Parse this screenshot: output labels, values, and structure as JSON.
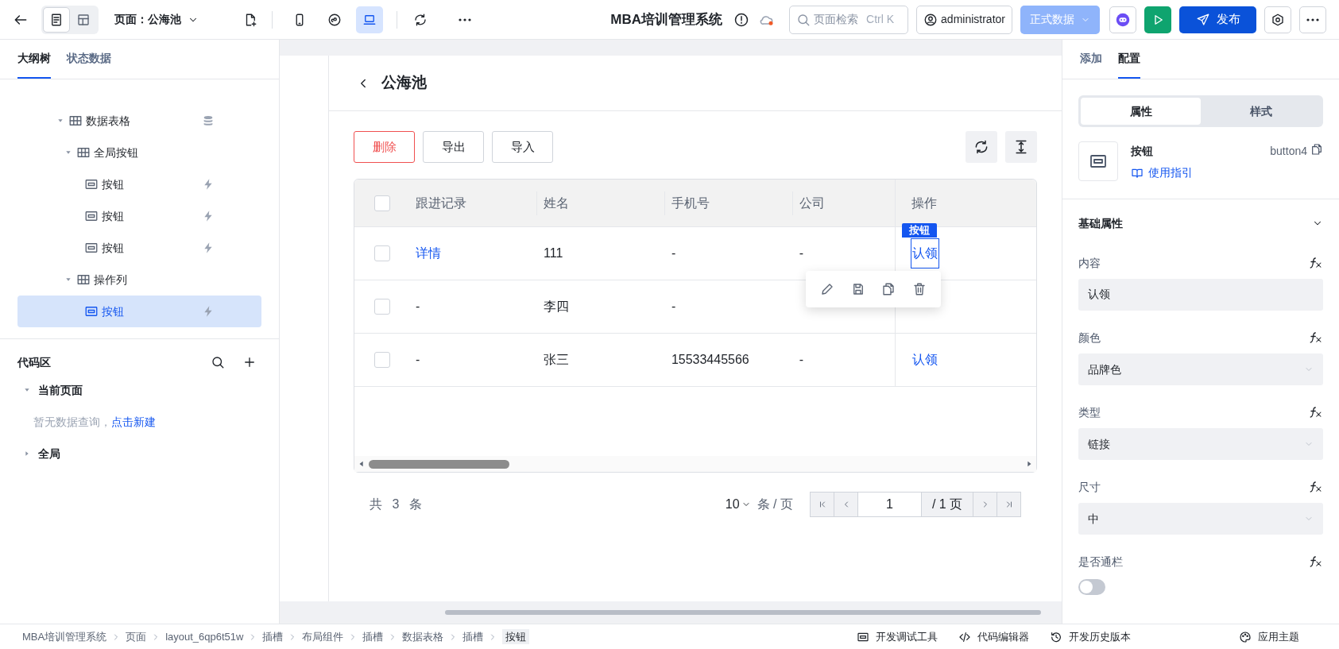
{
  "topbar": {
    "page_label": "页面：公海池",
    "view_toggle": [
      {
        "kind": "page",
        "selected": true
      },
      {
        "kind": "layout",
        "selected": false
      }
    ],
    "devices": [
      {
        "kind": "phone",
        "selected": false
      },
      {
        "kind": "miniapp",
        "selected": false
      },
      {
        "kind": "laptop",
        "selected": true
      }
    ],
    "app_title": "MBA培训管理系统",
    "search": {
      "placeholder": "页面检索",
      "shortcut": "Ctrl K"
    },
    "user": "administrator",
    "env": "正式数据",
    "publish": "发布"
  },
  "left_tabs": [
    {
      "label": "大纲树",
      "selected": true
    },
    {
      "label": "状态数据",
      "selected": false
    }
  ],
  "tree": [
    {
      "label": "数据表格",
      "kind": "table",
      "expanded": true,
      "selected": false,
      "children": [
        {
          "label": "全局按钮",
          "kind": "table",
          "expanded": true,
          "selected": false,
          "children": [
            {
              "label": "按钮",
              "kind": "button",
              "selected": false
            },
            {
              "label": "按钮",
              "kind": "button",
              "selected": false
            },
            {
              "label": "按钮",
              "kind": "button",
              "selected": false
            }
          ]
        },
        {
          "label": "操作列",
          "kind": "table",
          "expanded": true,
          "selected": false,
          "children": [
            {
              "label": "按钮",
              "kind": "button",
              "selected": true
            }
          ]
        }
      ]
    }
  ],
  "code_area": {
    "title": "代码区",
    "groups": [
      {
        "label": "当前页面",
        "expanded": true,
        "empty_text": "暂无数据查询，",
        "empty_link": "点击新建"
      },
      {
        "label": "全局",
        "expanded": false
      }
    ]
  },
  "page": {
    "title": "公海池",
    "buttons": [
      {
        "label": "删除",
        "kind": "danger"
      },
      {
        "label": "导出",
        "kind": "default"
      },
      {
        "label": "导入",
        "kind": "default"
      }
    ],
    "table": {
      "columns": [
        "跟进记录",
        "姓名",
        "手机号",
        "公司",
        "操作"
      ],
      "selection_badge": "按钮",
      "select_all_checked": false,
      "rows": [
        {
          "checked": false,
          "cells": [
            {
              "text": "详情",
              "link": true
            },
            {
              "text": "111",
              "link": false
            },
            {
              "text": "-",
              "link": false
            },
            {
              "text": "-",
              "link": false
            }
          ],
          "action": {
            "text": "认领",
            "selected": true
          }
        },
        {
          "checked": false,
          "cells": [
            {
              "text": "-",
              "link": false
            },
            {
              "text": "李四",
              "link": false
            },
            {
              "text": "-",
              "link": false
            }
          ]
        },
        {
          "checked": false,
          "cells": [
            {
              "text": "-",
              "link": false
            },
            {
              "text": "张三",
              "link": false
            },
            {
              "text": "15533445566",
              "link": false
            },
            {
              "text": "-",
              "link": false
            }
          ],
          "action": {
            "text": "认领",
            "selected": false
          }
        }
      ]
    },
    "pagination": {
      "total": "共 3 条",
      "page_size": "10",
      "per_page": "条 / 页",
      "page": "1",
      "of_pages": "/ 1 页"
    }
  },
  "right_tabs": [
    {
      "label": "添加",
      "selected": false
    },
    {
      "label": "配置",
      "selected": true
    }
  ],
  "segments": [
    {
      "label": "属性",
      "selected": true
    },
    {
      "label": "样式",
      "selected": false
    }
  ],
  "component": {
    "name": "按钮",
    "guide": "使用指引",
    "id": "button4"
  },
  "section": {
    "title": "基础属性",
    "expanded": true,
    "fields": [
      {
        "label": "内容",
        "kind": "input",
        "value": "认领"
      },
      {
        "label": "颜色",
        "kind": "select",
        "value": "品牌色"
      },
      {
        "label": "类型",
        "kind": "select",
        "value": "链接"
      },
      {
        "label": "尺寸",
        "kind": "select",
        "value": "中"
      },
      {
        "label": "是否通栏",
        "kind": "toggle",
        "on": false
      }
    ]
  },
  "breadcrumb": [
    "MBA培训管理系统",
    "页面",
    "layout_6qp6t51w",
    "插槽",
    "布局组件",
    "插槽",
    "数据表格",
    "插槽",
    "按钮"
  ],
  "status_tools": [
    "开发调试工具",
    "代码编辑器",
    "开发历史版本"
  ],
  "theme": "应用主题"
}
